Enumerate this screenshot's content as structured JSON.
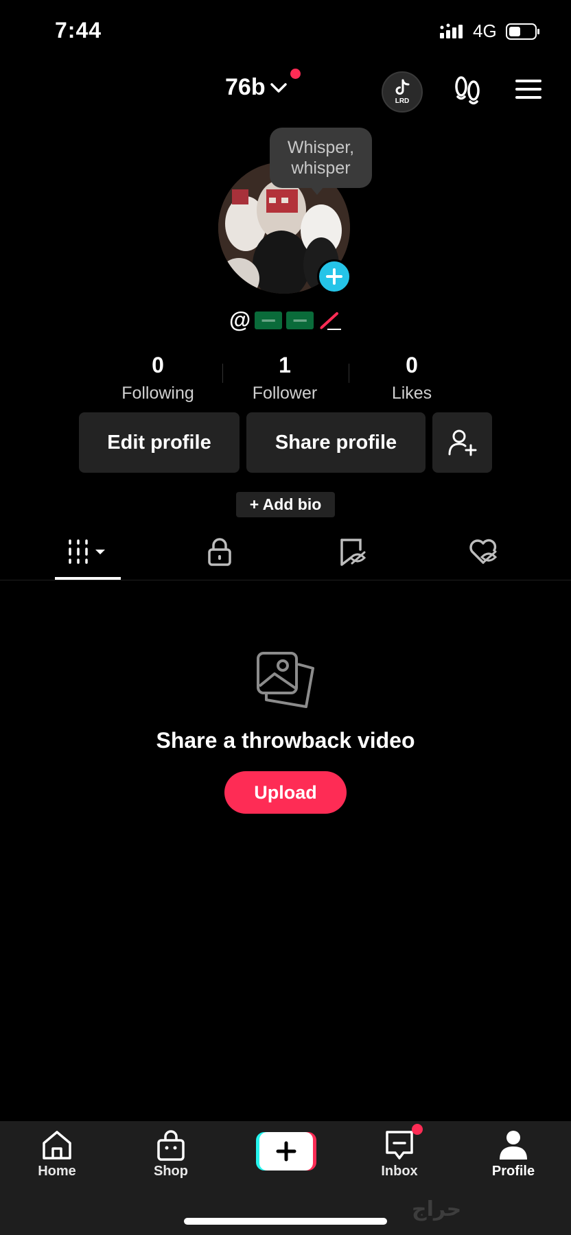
{
  "status_bar": {
    "time": "7:44",
    "network": "4G",
    "battery_level": 0.4
  },
  "header": {
    "account_name": "76b",
    "avatar_badge": "LRD"
  },
  "profile": {
    "tooltip": "Whisper, whisper",
    "username_prefix": "@"
  },
  "stats": [
    {
      "value": "0",
      "label": "Following"
    },
    {
      "value": "1",
      "label": "Follower"
    },
    {
      "value": "0",
      "label": "Likes"
    }
  ],
  "actions": {
    "edit": "Edit profile",
    "share": "Share profile",
    "add_bio": "+ Add bio"
  },
  "tabs": [
    "videos-grid-icon",
    "lock-icon",
    "saved-hidden-icon",
    "liked-hidden-icon"
  ],
  "empty_state": {
    "title": "Share a throwback video",
    "button": "Upload"
  },
  "bottom_nav": {
    "home": "Home",
    "shop": "Shop",
    "inbox": "Inbox",
    "profile": "Profile"
  },
  "watermark": "حراج",
  "colors": {
    "accent": "#fe2c55",
    "cyan": "#25c4e8",
    "surface": "#232323"
  }
}
